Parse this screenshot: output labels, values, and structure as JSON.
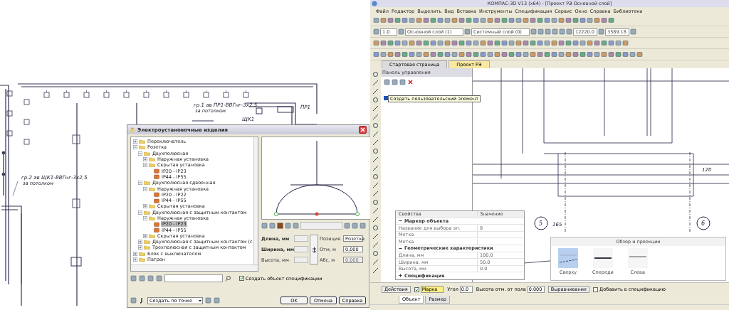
{
  "plan": {
    "labels": [
      {
        "text": "гр.1 ав ПР1-ВВГнг-3х2,5",
        "kind": "main"
      },
      {
        "text": "за потолком",
        "kind": "sub"
      },
      {
        "text": "гр.2 ав ЩК1-ВВГнг-3х2,5",
        "kind": "main"
      },
      {
        "text": "за потолком",
        "kind": "sub"
      },
      {
        "text": "ЩК1",
        "kind": "main"
      },
      {
        "text": "ПР1",
        "kind": "main"
      }
    ]
  },
  "dialog": {
    "title": "Электроустановочные изделия",
    "tree": [
      {
        "label": "Переключатель",
        "kind": "folder",
        "expanded": false,
        "selected": false
      },
      {
        "label": "Розетка",
        "kind": "folder",
        "expanded": true,
        "selected": false,
        "children": [
          {
            "label": "Двухполюсная",
            "kind": "folder",
            "expanded": true,
            "selected": false,
            "children": [
              {
                "label": "Наружная установка",
                "kind": "folder",
                "expanded": false,
                "selected": false
              },
              {
                "label": "Скрытая установка",
                "kind": "folder",
                "expanded": true,
                "selected": false,
                "children": [
                  {
                    "label": "IP20 - IP23",
                    "kind": "item",
                    "selected": false
                  },
                  {
                    "label": "IP44 - IP55",
                    "kind": "item",
                    "selected": false
                  }
                ]
              }
            ]
          },
          {
            "label": "Двухполюсная сдвоенная",
            "kind": "folder",
            "expanded": true,
            "selected": false,
            "children": [
              {
                "label": "Наружная установка",
                "kind": "folder",
                "expanded": true,
                "selected": false,
                "children": [
                  {
                    "label": "IP20 - IP22",
                    "kind": "item",
                    "selected": false
                  },
                  {
                    "label": "IP44 - IP55",
                    "kind": "item",
                    "selected": false
                  }
                ]
              },
              {
                "label": "Скрытая установка",
                "kind": "folder",
                "expanded": false,
                "selected": false
              }
            ]
          },
          {
            "label": "Двухполюсная с защитным контактом",
            "kind": "folder",
            "expanded": true,
            "selected": false,
            "children": [
              {
                "label": "Наружная установка",
                "kind": "folder",
                "expanded": true,
                "selected": false,
                "children": [
                  {
                    "label": "IP20 - IP23",
                    "kind": "item",
                    "selected": true
                  },
                  {
                    "label": "IP44 - IP55",
                    "kind": "item",
                    "selected": false
                  }
                ]
              },
              {
                "label": "Скрытая установка",
                "kind": "folder",
                "expanded": false,
                "selected": false
              }
            ]
          },
          {
            "label": "Двухполюсная с защитным контактом (с",
            "kind": "folder",
            "expanded": false,
            "selected": false
          },
          {
            "label": "Трехполюсная с защитным контактом",
            "kind": "folder",
            "expanded": false,
            "selected": false
          }
        ]
      },
      {
        "label": "Блок с выключателем",
        "kind": "folder",
        "expanded": false,
        "selected": false
      },
      {
        "label": "Патрон",
        "kind": "folder",
        "expanded": false,
        "selected": false
      }
    ],
    "size_fields": [
      {
        "label": "Длина, мм",
        "bold": true
      },
      {
        "label": "Ширина, мм",
        "bold": true
      },
      {
        "label": "Высота, мм",
        "bold": false
      }
    ],
    "pos_fields": [
      {
        "label": "Позиция",
        "value": "Розетка",
        "disabled": false
      },
      {
        "label": "Отм, м",
        "value": "0,000",
        "disabled": false
      },
      {
        "label": "Абс, м",
        "value": "0,000",
        "disabled": true
      }
    ],
    "spec_checkbox": {
      "label": "Создать объект спецификации",
      "checked": true
    },
    "mode_dropdown": "Создать по точке",
    "buttons": [
      "OK",
      "Отмена",
      "Справка"
    ]
  },
  "app": {
    "title": "КОМПАС-3D V13 (x64) - [Проект РЭ Основной слой]",
    "menu": [
      "Файл",
      "Редактор",
      "Выделить",
      "Вид",
      "Вставка",
      "Инструменты",
      "Спецификация",
      "Сервис",
      "Окно",
      "Справка",
      "Библиотеки"
    ],
    "toolbar_fields": [
      {
        "value": "1.0",
        "kind": "small"
      },
      {
        "value": "Основной слой (1)",
        "kind": "wide"
      },
      {
        "value": "Системный слой (0)",
        "kind": "wide"
      },
      {
        "value": "12220.0",
        "kind": "coord"
      },
      {
        "value": "3589.18",
        "kind": "coord"
      }
    ],
    "tabs": [
      {
        "label": "Стартовая страница",
        "selected": false
      },
      {
        "label": "Проект РЭ",
        "selected": true
      }
    ],
    "panel_title": "Панель управления",
    "tooltip": "Создать пользовательский элемент",
    "dims": [
      {
        "text": "120",
        "kind": "dim"
      },
      {
        "text": "5",
        "kind": "axis"
      },
      {
        "text": "165",
        "kind": "dim"
      },
      {
        "text": "6",
        "kind": "axis"
      }
    ],
    "properties": {
      "columns": [
        "Свойства",
        "Значение"
      ],
      "rows": [
        {
          "kind": "group",
          "label": "Маркер объекта",
          "expanded": true
        },
        {
          "kind": "row",
          "label": "Название для выбора эл.",
          "value": "8"
        },
        {
          "kind": "row",
          "label": "Метка",
          "value": ""
        },
        {
          "kind": "row",
          "label": "Метка",
          "value": ""
        },
        {
          "kind": "group",
          "label": "Геометрические характеристики",
          "expanded": true
        },
        {
          "kind": "row",
          "label": "Длина, мм",
          "value": "100.0"
        },
        {
          "kind": "row",
          "label": "Ширина, мм",
          "value": "50.0"
        },
        {
          "kind": "row",
          "label": "Высота, мм",
          "value": "0.0"
        },
        {
          "kind": "group",
          "label": "Спецификация",
          "expanded": false
        }
      ]
    },
    "views": {
      "title": "Обзор и проекции",
      "items": [
        {
          "label": "Сверху",
          "selected": true
        },
        {
          "label": "Спереди",
          "selected": false
        },
        {
          "label": "Слева",
          "selected": false
        }
      ]
    },
    "bottom_controls": [
      {
        "kind": "dropdown",
        "label": "Действия"
      },
      {
        "kind": "checkfield",
        "label": "Марка",
        "checked": true
      },
      {
        "kind": "labeled",
        "label": "Угол",
        "value": "0.0"
      },
      {
        "kind": "labeled",
        "label": "Высота отм. от пола",
        "value": "0.000"
      },
      {
        "kind": "dropdown",
        "label": "Выравнивание"
      },
      {
        "kind": "check",
        "label": "Добавить в спецификацию",
        "checked": false
      }
    ],
    "bottom_tabs": [
      {
        "label": "Объект",
        "selected": true
      },
      {
        "label": "Размер",
        "selected": false
      }
    ]
  }
}
